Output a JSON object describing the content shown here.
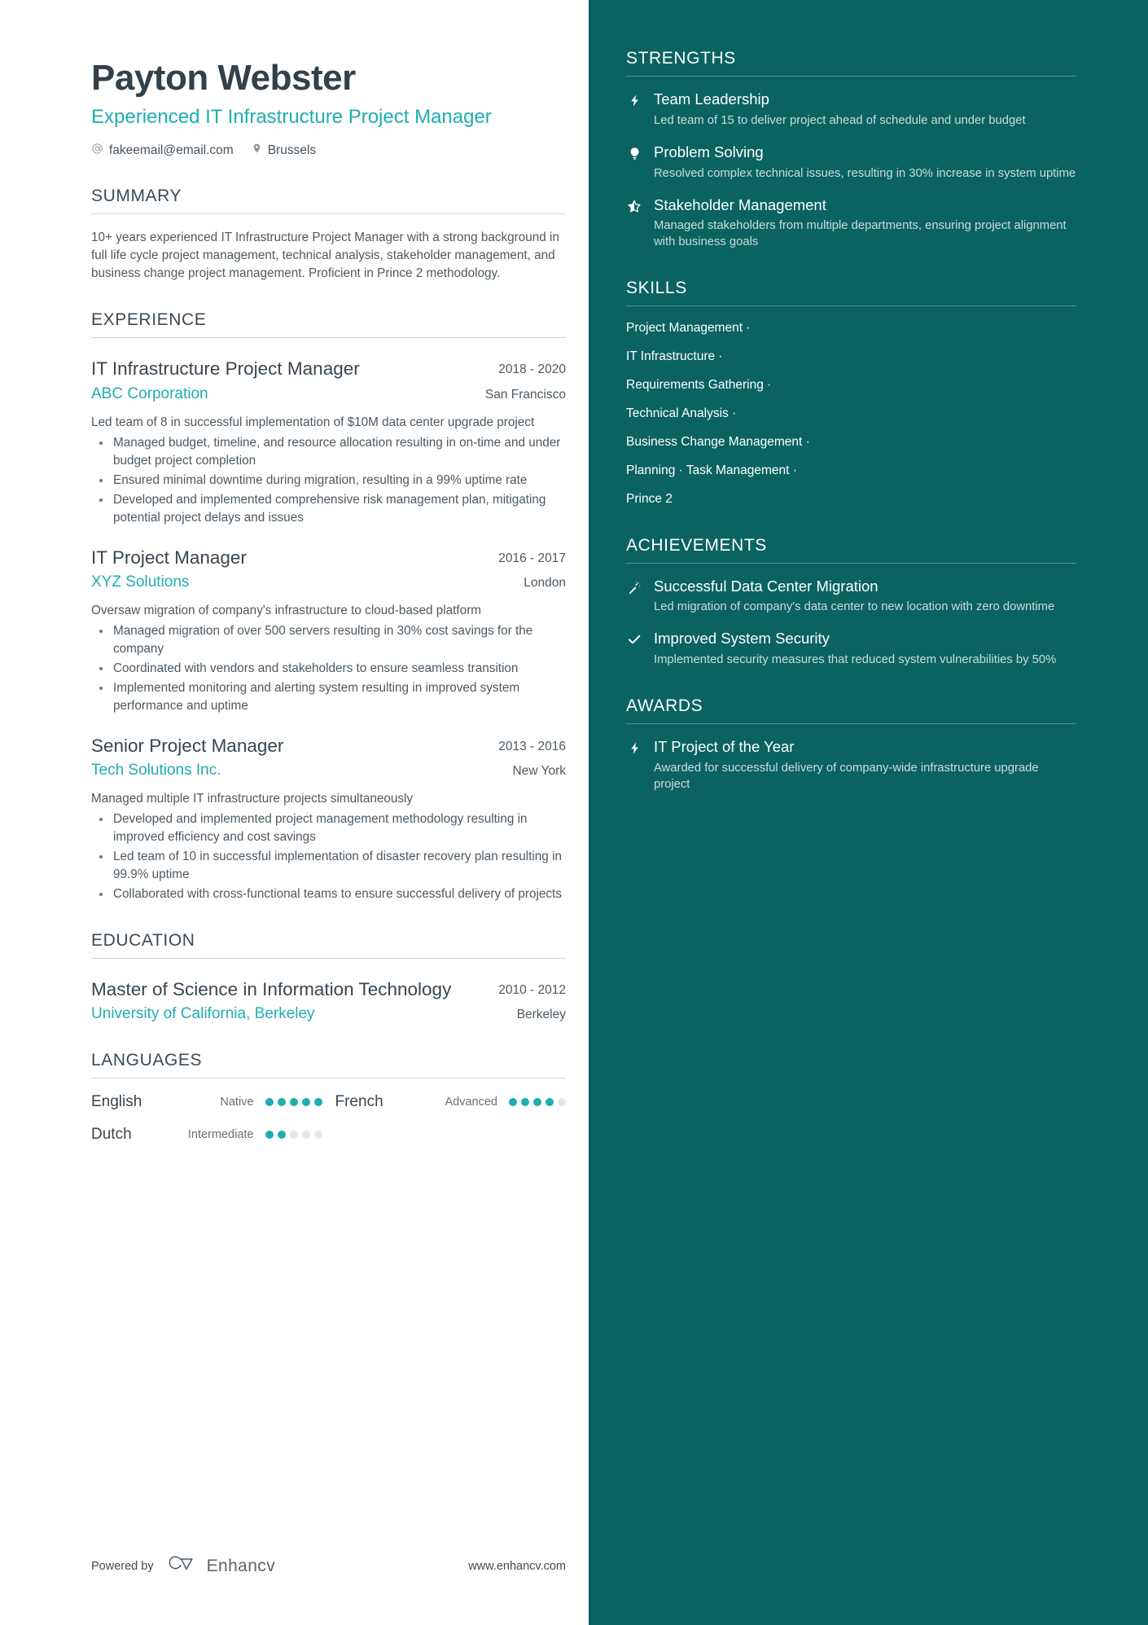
{
  "theme": {
    "accent": "#1fadb0",
    "sidebar_bg": "#0a6360",
    "heading": "#39454f",
    "body_text": "#4d5962"
  },
  "header": {
    "name": "Payton Webster",
    "headline": "Experienced IT Infrastructure Project Manager",
    "email": "fakeemail@email.com",
    "location": "Brussels"
  },
  "summary": {
    "title": "SUMMARY",
    "text": "10+ years experienced IT Infrastructure Project Manager with a strong background in full life cycle project management, technical analysis, stakeholder management, and business change project management. Proficient in Prince 2 methodology."
  },
  "experience": {
    "title": "EXPERIENCE",
    "entries": [
      {
        "role": "IT Infrastructure Project Manager",
        "dates": "2018 - 2020",
        "company": "ABC Corporation",
        "location": "San Francisco",
        "description": "Led team of 8 in successful implementation of $10M data center upgrade project",
        "bullets": [
          "Managed budget, timeline, and resource allocation resulting in on-time and under budget project completion",
          "Ensured minimal downtime during migration, resulting in a 99% uptime rate",
          "Developed and implemented comprehensive risk management plan, mitigating potential project delays and issues"
        ]
      },
      {
        "role": "IT Project Manager",
        "dates": "2016 - 2017",
        "company": "XYZ Solutions",
        "location": "London",
        "description": "Oversaw migration of company's infrastructure to cloud-based platform",
        "bullets": [
          "Managed migration of over 500 servers resulting in 30% cost savings for the company",
          "Coordinated with vendors and stakeholders to ensure seamless transition",
          "Implemented monitoring and alerting system resulting in improved system performance and uptime"
        ]
      },
      {
        "role": "Senior Project Manager",
        "dates": "2013 - 2016",
        "company": "Tech Solutions Inc.",
        "location": "New York",
        "description": "Managed multiple IT infrastructure projects simultaneously",
        "bullets": [
          "Developed and implemented project management methodology resulting in improved efficiency and cost savings",
          "Led team of 10 in successful implementation of disaster recovery plan resulting in 99.9% uptime",
          "Collaborated with cross-functional teams to ensure successful delivery of projects"
        ]
      }
    ]
  },
  "education": {
    "title": "EDUCATION",
    "entries": [
      {
        "degree": "Master of Science in Information Technology",
        "dates": "2010 - 2012",
        "school": "University of California, Berkeley",
        "location": "Berkeley"
      }
    ]
  },
  "languages": {
    "title": "LANGUAGES",
    "items": [
      {
        "name": "English",
        "level": "Native",
        "rating": 5,
        "max": 5
      },
      {
        "name": "French",
        "level": "Advanced",
        "rating": 4,
        "max": 5
      },
      {
        "name": "Dutch",
        "level": "Intermediate",
        "rating": 2,
        "max": 5
      }
    ]
  },
  "footer": {
    "powered_by": "Powered by",
    "brand": "Enhancv",
    "url": "www.enhancv.com",
    "logo_icon": "enhancv-logo-icon"
  },
  "strengths": {
    "title": "STRENGTHS",
    "items": [
      {
        "icon": "lightning-bolt-icon",
        "title": "Team Leadership",
        "desc": "Led team of 15 to deliver project ahead of schedule and under budget"
      },
      {
        "icon": "lightbulb-icon",
        "title": "Problem Solving",
        "desc": "Resolved complex technical issues, resulting in 30% increase in system uptime"
      },
      {
        "icon": "star-half-icon",
        "title": "Stakeholder Management",
        "desc": "Managed stakeholders from multiple departments, ensuring project alignment with business goals"
      }
    ]
  },
  "skills": {
    "title": "SKILLS",
    "lines": [
      "Project Management ·",
      "IT Infrastructure ·",
      "Requirements Gathering ·",
      "Technical Analysis ·",
      "Business Change Management ·",
      "Planning · Task Management ·",
      "Prince 2"
    ]
  },
  "achievements": {
    "title": "ACHIEVEMENTS",
    "items": [
      {
        "icon": "magic-wand-icon",
        "title": "Successful Data Center Migration",
        "desc": "Led migration of company's data center to new location with zero downtime"
      },
      {
        "icon": "check-icon",
        "title": "Improved System Security",
        "desc": "Implemented security measures that reduced system vulnerabilities by 50%"
      }
    ]
  },
  "awards": {
    "title": "AWARDS",
    "items": [
      {
        "icon": "lightning-bolt-icon",
        "title": "IT Project of the Year",
        "desc": "Awarded for successful delivery of company-wide infrastructure upgrade project"
      }
    ]
  }
}
